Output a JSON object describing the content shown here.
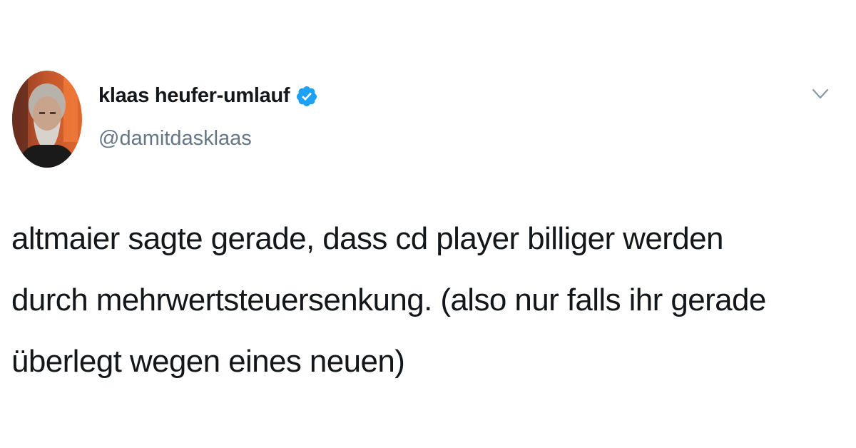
{
  "author": {
    "display_name": "klaas heufer-umlauf",
    "handle": "@damitdasklaas",
    "verified": true
  },
  "tweet": {
    "text": "altmaier sagte gerade, dass cd player billiger werden\ndurch mehrwertsteuersenkung. (also nur falls ihr gerade\nüberlegt wegen eines neuen)"
  },
  "icons": {
    "verified": "verified-badge-icon",
    "more": "chevron-down-icon"
  },
  "colors": {
    "text": "#14171a",
    "secondary": "#657786",
    "verified_blue": "#1da1f2",
    "chevron": "#8899a6",
    "background": "#ffffff"
  }
}
